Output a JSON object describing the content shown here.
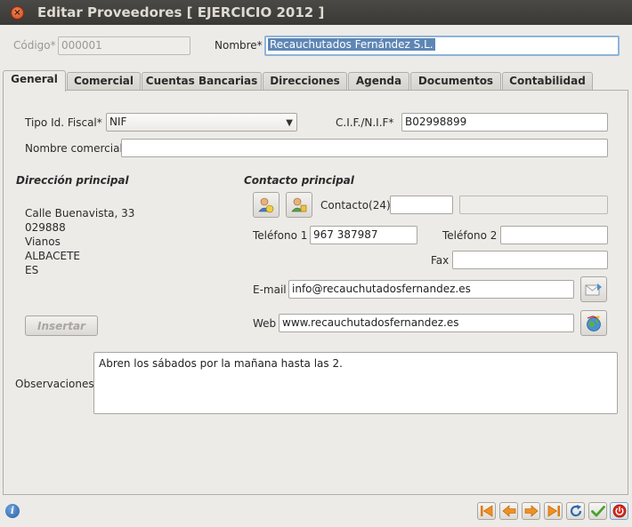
{
  "window": {
    "title": "Editar Proveedores [ EJERCICIO 2012 ]"
  },
  "header": {
    "codigo_label": "Código*",
    "codigo_value": "000001",
    "nombre_label": "Nombre*",
    "nombre_value": "Recauchutados Fernández S.L."
  },
  "tabs": [
    {
      "label": "General"
    },
    {
      "label": "Comercial"
    },
    {
      "label": "Cuentas Bancarias"
    },
    {
      "label": "Direcciones"
    },
    {
      "label": "Agenda"
    },
    {
      "label": "Documentos"
    },
    {
      "label": "Contabilidad"
    }
  ],
  "general": {
    "tipo_id_label": "Tipo Id. Fiscal*",
    "tipo_id_value": "NIF",
    "cif_label": "C.I.F./N.I.F*",
    "cif_value": "B02998899",
    "nombre_comercial_label": "Nombre comercial",
    "nombre_comercial_value": ""
  },
  "direccion": {
    "title": "Dirección principal",
    "lines": [
      "Calle Buenavista, 33",
      "029888",
      "Vianos",
      "ALBACETE",
      "ES"
    ],
    "insertar_label": "Insertar"
  },
  "contacto": {
    "title": "Contacto principal",
    "contacto_label": "Contacto(24)",
    "contacto_value": "",
    "contacto_extra": "",
    "telefono1_label": "Teléfono 1",
    "telefono1_value": "967 387987",
    "telefono2_label": "Teléfono 2",
    "telefono2_value": "",
    "fax_label": "Fax",
    "fax_value": "",
    "email_label": "E-mail",
    "email_value": "info@recauchutadosfernandez.es",
    "web_label": "Web",
    "web_value": "www.recauchutadosfernandez.es"
  },
  "observaciones": {
    "label": "Observaciones",
    "value": "Abren los sábados por la mañana hasta las 2."
  },
  "colors": {
    "accent": "#5e86b5",
    "titlebar": "#3c3b37",
    "close": "#e0592a"
  }
}
